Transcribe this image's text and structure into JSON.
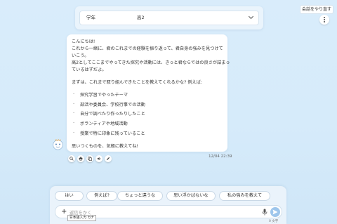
{
  "grade": {
    "label": "学年",
    "value": "高2"
  },
  "header": {
    "restart_label": "会話をやり直す"
  },
  "message": {
    "lines": [
      "こんにちは!",
      "これから一緒に、君のこれまでの経験を振り返って、君自身の強みを見つけて",
      "いこう。",
      "高2としてここまでやってきた探究や活動には、きっと君ならではの良さが詰まっ",
      "ているはずだよ。",
      "まずは、これまで取り組んできたことを教えてくれるかな? 例えば:"
    ],
    "bullets": [
      "探究学習でやったテーマ",
      "部活や委員会、学校行事での活動",
      "自分で調べたり作ったりしたこと",
      "ボランティアや地域活動",
      "授業で特に印象に残っていること"
    ],
    "closing": "思いつくものを、気軽に教えてね!",
    "timestamp": "12/04 22:39"
  },
  "actions": [
    "search-icon",
    "print-icon",
    "copy-icon",
    "speaker-icon",
    "edit-icon"
  ],
  "suggestions": [
    "はい",
    "例えば?",
    "ちょっと違うな",
    "思い浮かばないな",
    "私の強みを教えて"
  ],
  "composer": {
    "placeholder": "返信をかく",
    "char_count": "0 文字"
  },
  "ime": {
    "mode": "日本語入力 カナ"
  },
  "colors": {
    "background": "#d6ebfa",
    "send": "#9ec6ec"
  }
}
